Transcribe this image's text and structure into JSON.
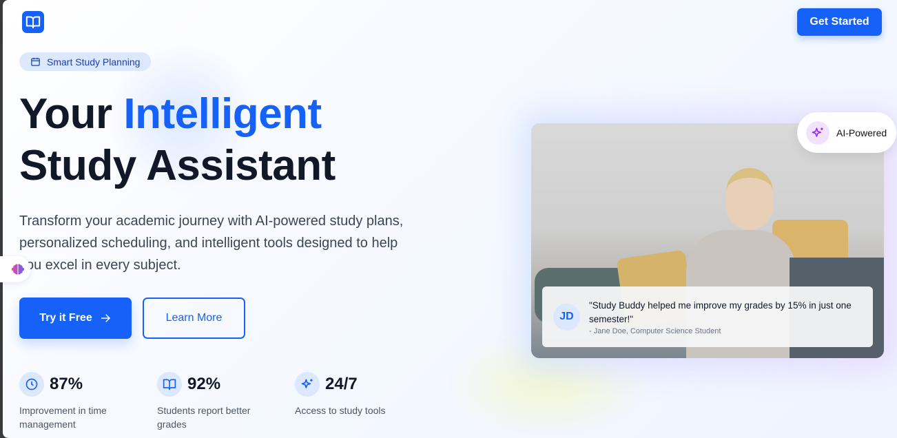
{
  "header": {
    "logo_icon": "book-open-icon",
    "cta_label": "Get Started"
  },
  "hero": {
    "badge": {
      "icon": "calendar-icon",
      "label": "Smart Study Planning"
    },
    "title_part1": "Your ",
    "title_accent": "Intelligent",
    "title_line2": "Study Assistant",
    "description": "Transform your academic journey with AI-powered study plans, personalized scheduling, and intelligent tools designed to help you excel in every subject.",
    "primary_button": "Try it Free",
    "secondary_button": "Learn More",
    "floating_icon": "brain-icon"
  },
  "stats": [
    {
      "icon": "clock-icon",
      "value": "87%",
      "label": "Improvement in time management"
    },
    {
      "icon": "book-open-icon",
      "value": "92%",
      "label": "Students report better grades"
    },
    {
      "icon": "sparkles-icon",
      "value": "24/7",
      "label": "Access to study tools"
    }
  ],
  "showcase": {
    "ai_badge": {
      "icon": "sparkles-icon",
      "label": "AI-Powered"
    },
    "testimonial": {
      "initials": "JD",
      "quote": "\"Study Buddy helped me improve my grades by 15% in just one semester!\"",
      "author": "- Jane Doe, Computer Science Student"
    }
  },
  "colors": {
    "primary": "#1662f8",
    "text": "#111827",
    "badge_bg": "#dce8fd",
    "ai_accent": "#9b2cf0"
  }
}
